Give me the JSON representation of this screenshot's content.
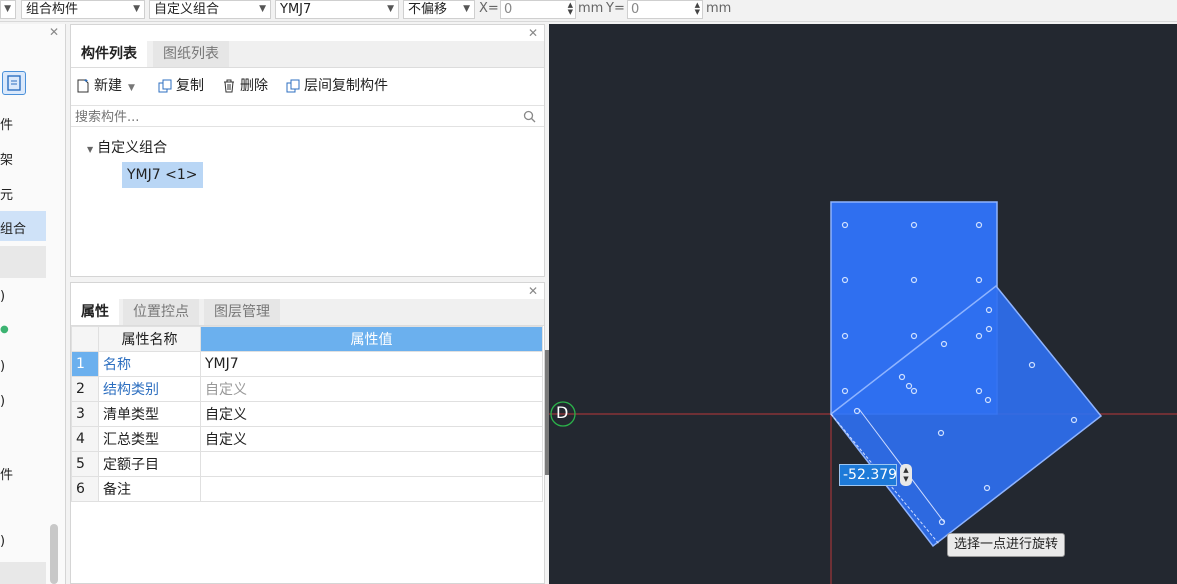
{
  "toolbar": {
    "combo1": "",
    "combo2": "组合构件",
    "combo3": "自定义组合",
    "combo4": "YMJ7",
    "combo5": "不偏移",
    "x_label": "X=",
    "x_value": "0",
    "unit1": "mm",
    "y_label": "Y=",
    "y_value": "0",
    "unit2": "mm"
  },
  "left_strip": {
    "items": [
      "件",
      "架",
      "元",
      "组合",
      ")",
      ")",
      ")",
      "件",
      ")"
    ]
  },
  "component_panel": {
    "tabs": [
      "构件列表",
      "图纸列表"
    ],
    "buttons": {
      "new": "新建",
      "copy": "复制",
      "delete": "删除",
      "floor_copy": "层间复制构件"
    },
    "search_placeholder": "搜索构件...",
    "tree": {
      "group": "自定义组合",
      "item": "YMJ7 <1>"
    }
  },
  "property_panel": {
    "tabs": [
      "属性",
      "位置控点",
      "图层管理"
    ],
    "headers": {
      "name": "属性名称",
      "value": "属性值"
    },
    "rows": [
      {
        "num": "1",
        "name": "名称",
        "value": "YMJ7"
      },
      {
        "num": "2",
        "name": "结构类别",
        "value": "自定义"
      },
      {
        "num": "3",
        "name": "清单类型",
        "value": "自定义"
      },
      {
        "num": "4",
        "name": "汇总类型",
        "value": "自定义"
      },
      {
        "num": "5",
        "name": "定额子目",
        "value": ""
      },
      {
        "num": "6",
        "name": "备注",
        "value": ""
      }
    ]
  },
  "canvas": {
    "axis_label": "D",
    "angle_value": "-52.379",
    "tooltip": "选择一点进行旋转",
    "colors": {
      "background": "#232830",
      "shape": "#2f6ff0",
      "axis": "#c0393b"
    }
  }
}
